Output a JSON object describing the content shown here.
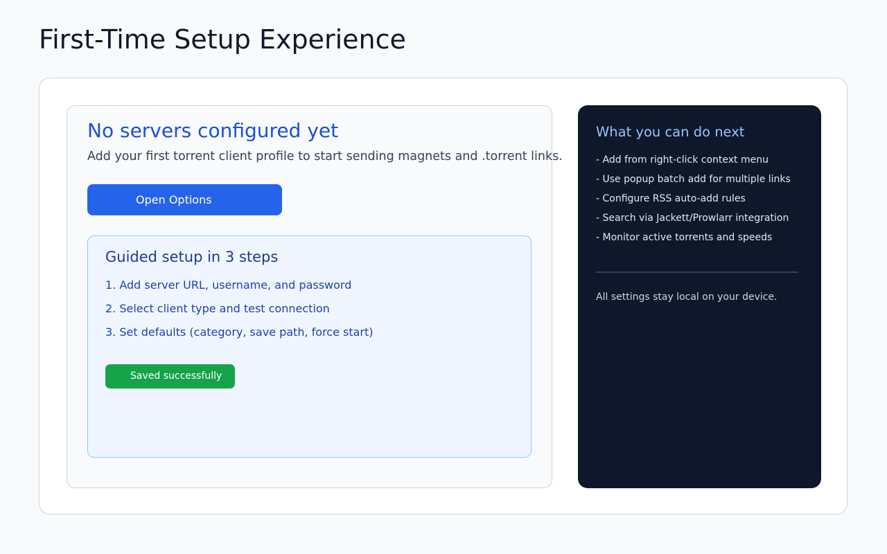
{
  "page": {
    "title": "First-Time Setup Experience"
  },
  "empty_state": {
    "title": "No servers configured yet",
    "description": "Add your first torrent client profile to start sending magnets and .torrent links.",
    "open_options_label": "Open Options"
  },
  "guide": {
    "title": "Guided setup in 3 steps",
    "steps": [
      "1. Add server URL, username, and password",
      "2. Select client type and test connection",
      "3. Set defaults (category, save path, force start)"
    ],
    "status_badge": "Saved successfully"
  },
  "next_panel": {
    "title": "What you can do next",
    "items": [
      "- Add from right-click context menu",
      "- Use popup batch add for multiple links",
      "- Configure RSS auto-add rules",
      "- Search via Jackett/Prowlarr integration",
      "- Monitor active torrents and speeds"
    ],
    "privacy_note": "All settings stay local on your device."
  },
  "colors": {
    "accent": "#2563eb",
    "success": "#16a34a",
    "dark_panel": "#0f172a",
    "heading_blue": "#1d4ed8"
  }
}
